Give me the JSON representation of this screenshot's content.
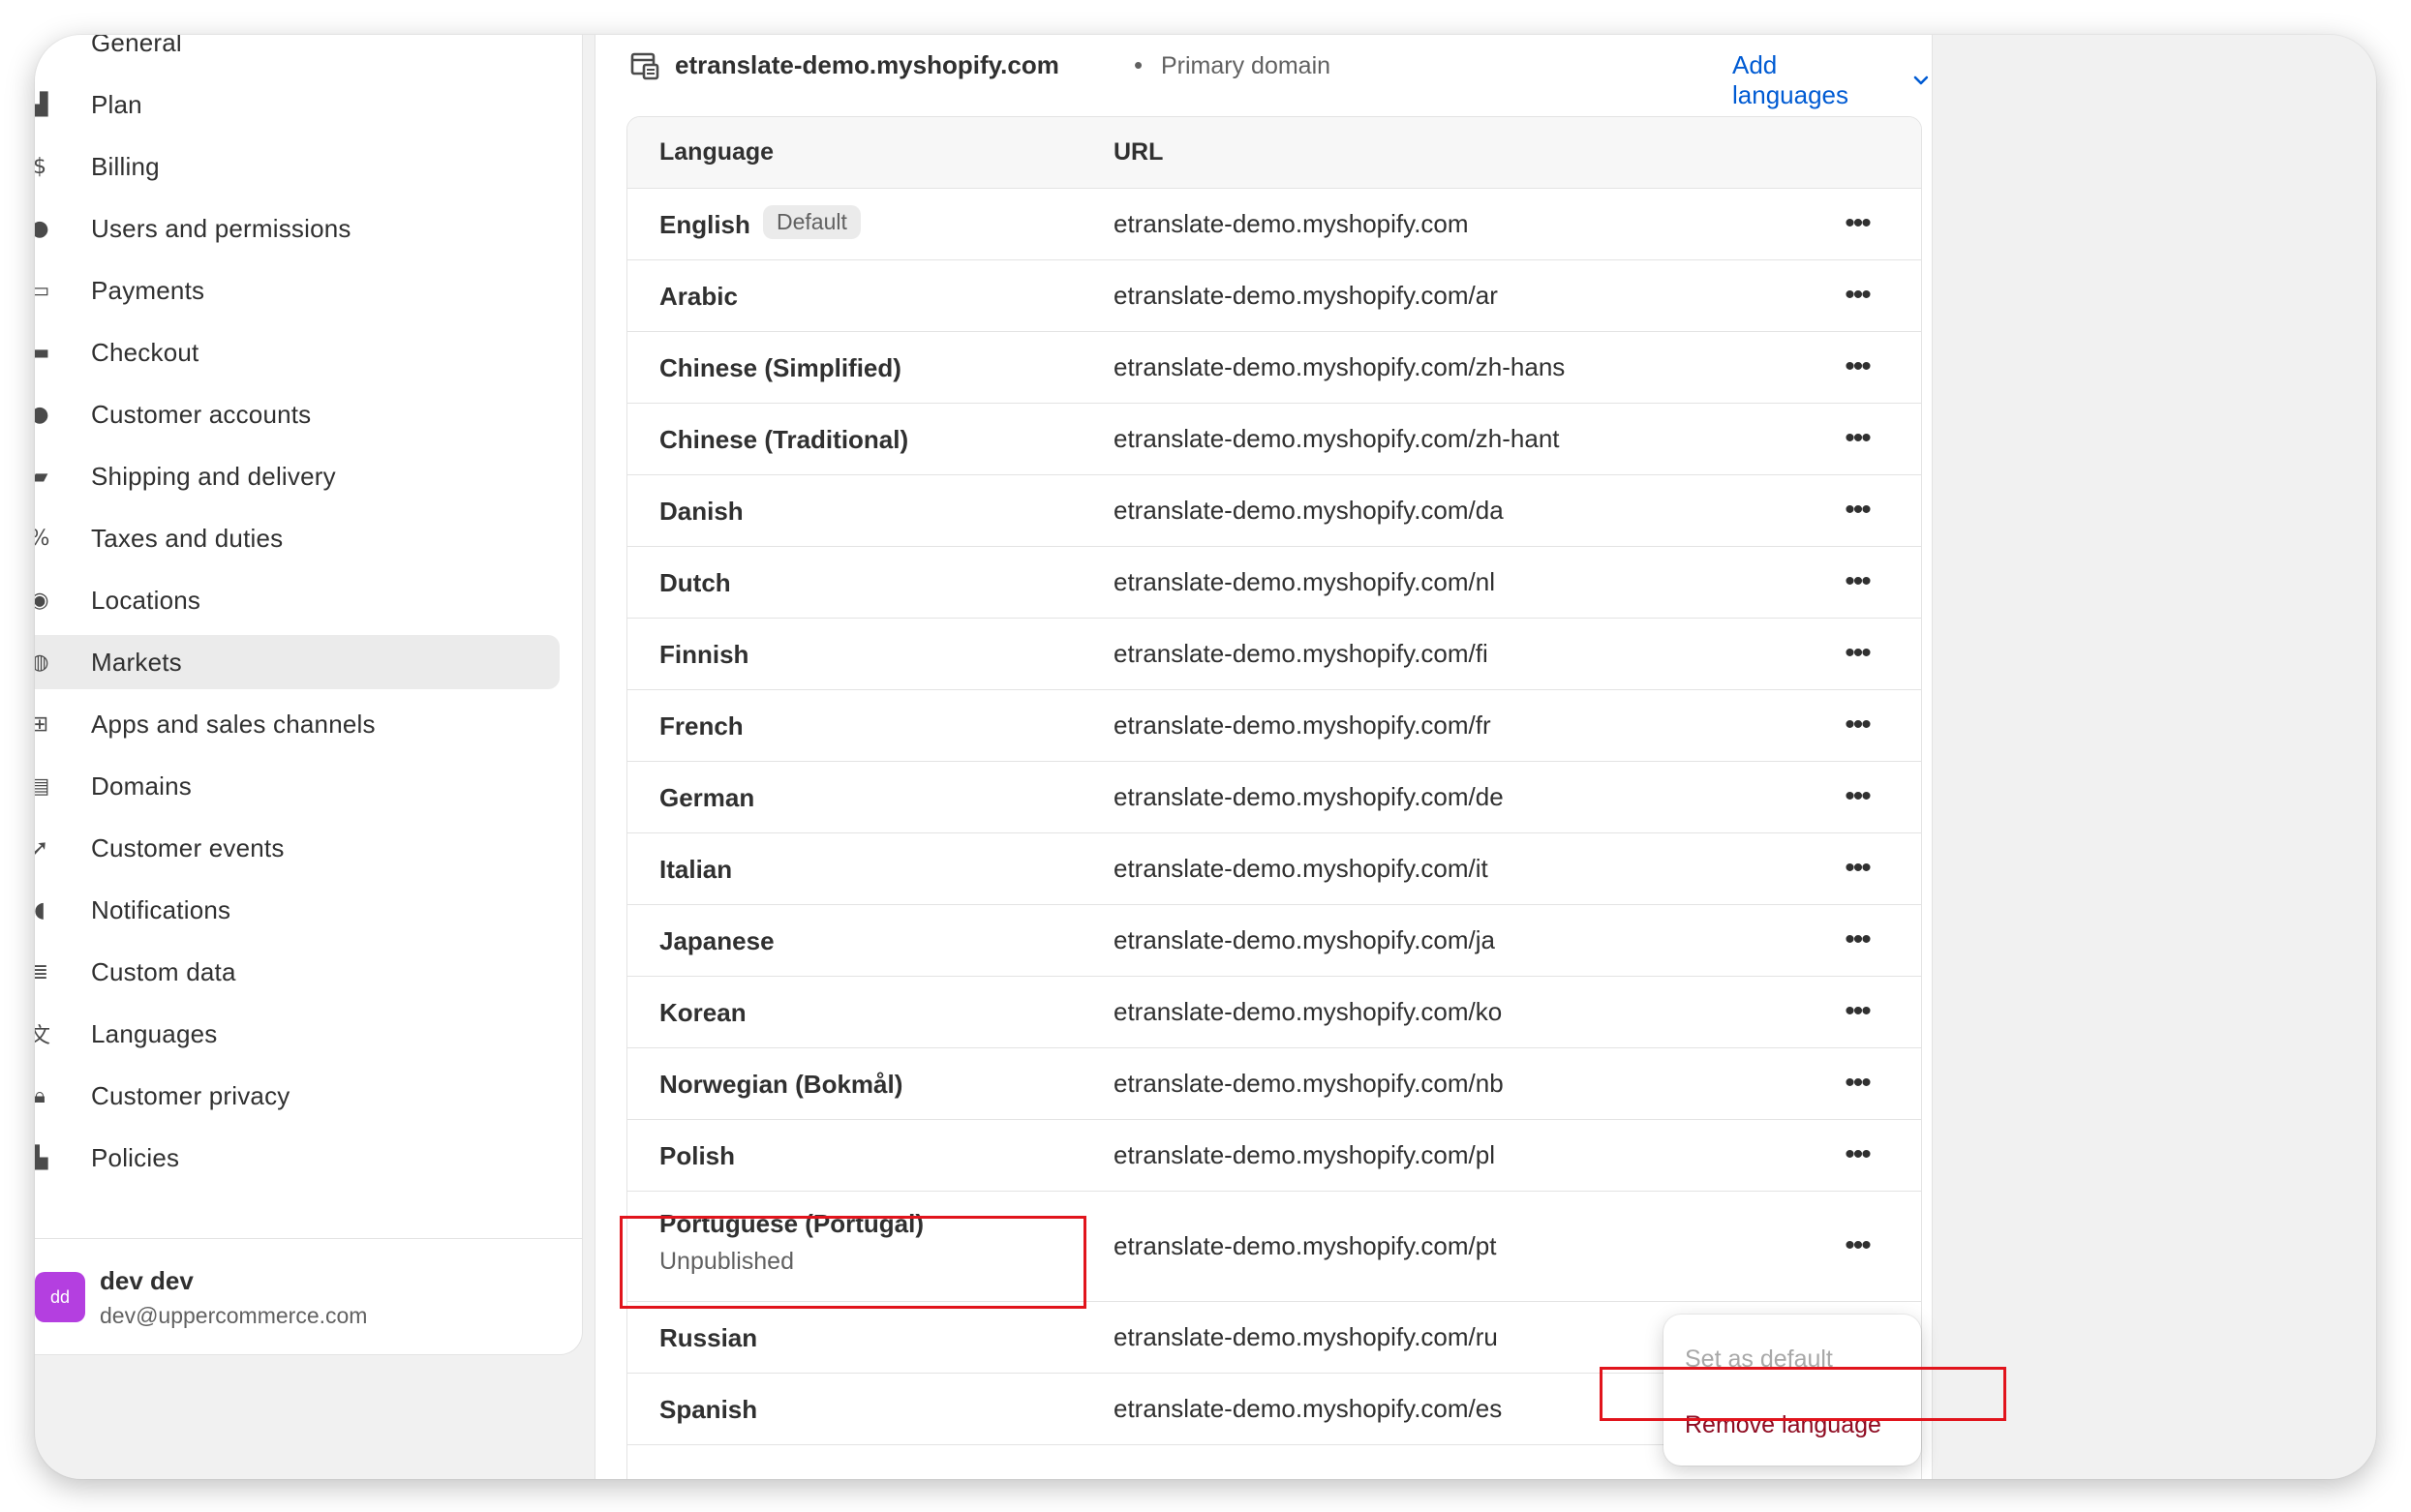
{
  "sidebar": {
    "items": [
      {
        "label": "General",
        "icon": "store-icon"
      },
      {
        "label": "Plan",
        "icon": "plan-icon"
      },
      {
        "label": "Billing",
        "icon": "billing-icon"
      },
      {
        "label": "Users and permissions",
        "icon": "users-icon"
      },
      {
        "label": "Payments",
        "icon": "payments-icon"
      },
      {
        "label": "Checkout",
        "icon": "cart-icon"
      },
      {
        "label": "Customer accounts",
        "icon": "person-icon"
      },
      {
        "label": "Shipping and delivery",
        "icon": "truck-icon"
      },
      {
        "label": "Taxes and duties",
        "icon": "tax-icon"
      },
      {
        "label": "Locations",
        "icon": "location-icon"
      },
      {
        "label": "Markets",
        "icon": "globe-icon"
      },
      {
        "label": "Apps and sales channels",
        "icon": "apps-icon"
      },
      {
        "label": "Domains",
        "icon": "domains-icon"
      },
      {
        "label": "Customer events",
        "icon": "cursor-icon"
      },
      {
        "label": "Notifications",
        "icon": "bell-icon"
      },
      {
        "label": "Custom data",
        "icon": "data-icon"
      },
      {
        "label": "Languages",
        "icon": "language-icon"
      },
      {
        "label": "Customer privacy",
        "icon": "lock-icon"
      },
      {
        "label": "Policies",
        "icon": "policies-icon"
      }
    ],
    "active": "Markets",
    "user": {
      "initials": "dd",
      "name": "dev dev",
      "email": "dev@uppercommerce.com"
    }
  },
  "domain": {
    "name": "etranslate-demo.myshopify.com",
    "separator": "•",
    "type": "Primary domain",
    "add_languages": "Add languages"
  },
  "table": {
    "headers": {
      "language": "Language",
      "url": "URL"
    },
    "rows": [
      {
        "language": "English",
        "badge": "Default",
        "url": "etranslate-demo.myshopify.com"
      },
      {
        "language": "Arabic",
        "url": "etranslate-demo.myshopify.com/ar"
      },
      {
        "language": "Chinese (Simplified)",
        "url": "etranslate-demo.myshopify.com/zh-hans"
      },
      {
        "language": "Chinese (Traditional)",
        "url": "etranslate-demo.myshopify.com/zh-hant"
      },
      {
        "language": "Danish",
        "url": "etranslate-demo.myshopify.com/da"
      },
      {
        "language": "Dutch",
        "url": "etranslate-demo.myshopify.com/nl"
      },
      {
        "language": "Finnish",
        "url": "etranslate-demo.myshopify.com/fi"
      },
      {
        "language": "French",
        "url": "etranslate-demo.myshopify.com/fr"
      },
      {
        "language": "German",
        "url": "etranslate-demo.myshopify.com/de"
      },
      {
        "language": "Italian",
        "url": "etranslate-demo.myshopify.com/it"
      },
      {
        "language": "Japanese",
        "url": "etranslate-demo.myshopify.com/ja"
      },
      {
        "language": "Korean",
        "url": "etranslate-demo.myshopify.com/ko"
      },
      {
        "language": "Norwegian (Bokmål)",
        "url": "etranslate-demo.myshopify.com/nb"
      },
      {
        "language": "Polish",
        "url": "etranslate-demo.myshopify.com/pl"
      },
      {
        "language": "Portuguese (Portugal)",
        "status": "Unpublished",
        "url": "etranslate-demo.myshopify.com/pt"
      },
      {
        "language": "Russian",
        "url": "etranslate-demo.myshopify.com/ru"
      },
      {
        "language": "Spanish",
        "url": "etranslate-demo.myshopify.com/es"
      }
    ],
    "more_glyph": "•••"
  },
  "popover": {
    "set_default": "Set as default",
    "remove_language": "Remove language"
  },
  "colors": {
    "link": "#005bd3",
    "critical": "#8e0b21",
    "annotation": "#e1141c",
    "avatar": "#b43fe0"
  }
}
